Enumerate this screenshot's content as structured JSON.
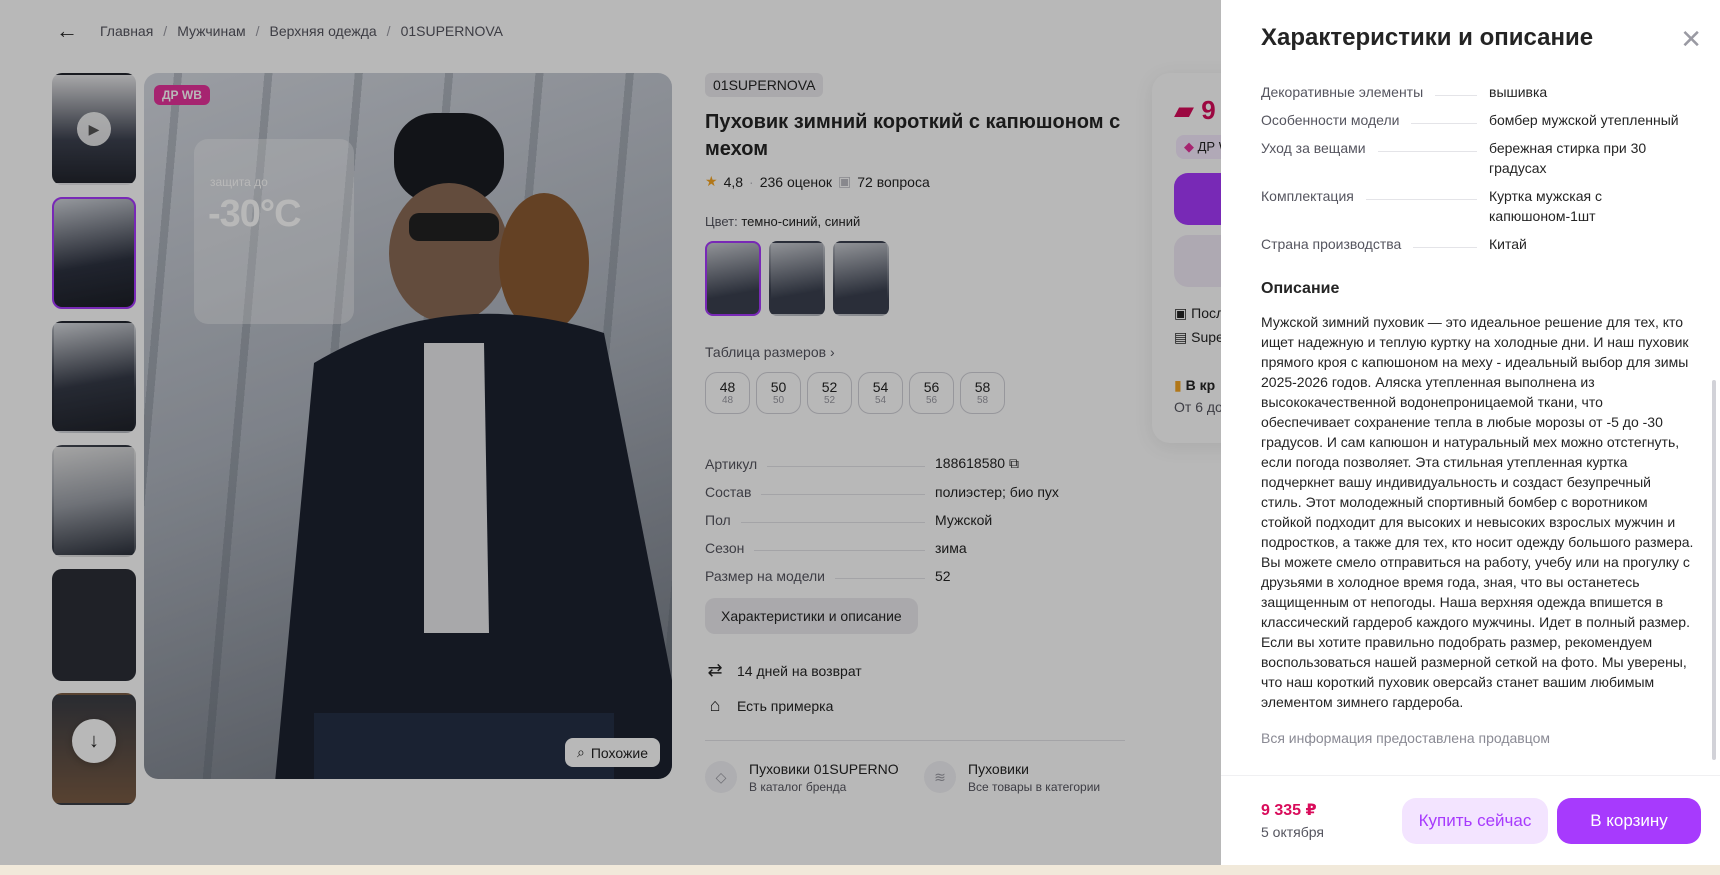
{
  "breadcrumb": {
    "items": [
      "Главная",
      "Мужчинам",
      "Верхняя одежда",
      "01SUPERNOVA"
    ]
  },
  "gallery": {
    "badge": "ДР WB",
    "protection_label": "защита до",
    "protection_value": "-30°C",
    "similar_label": "Похожие"
  },
  "product": {
    "brand": "01SUPERNOVA",
    "title": "Пуховик зимний короткий с капюшоном с мехом",
    "rating": "4,8",
    "reviews": "236 оценок",
    "questions": "72 вопроса",
    "color_label": "Цвет:",
    "color_value": "темно-синий, синий",
    "size_table_label": "Таблица размеров",
    "sizes": [
      {
        "main": "48",
        "sub": "48"
      },
      {
        "main": "50",
        "sub": "50"
      },
      {
        "main": "52",
        "sub": "52"
      },
      {
        "main": "54",
        "sub": "54"
      },
      {
        "main": "56",
        "sub": "56"
      },
      {
        "main": "58",
        "sub": "58"
      }
    ],
    "specs": [
      {
        "k": "Артикул",
        "v": "188618580"
      },
      {
        "k": "Состав",
        "v": "полиэстер; био пух"
      },
      {
        "k": "Пол",
        "v": "Мужской"
      },
      {
        "k": "Сезон",
        "v": "зима"
      },
      {
        "k": "Размер на модели",
        "v": "52"
      }
    ],
    "char_button": "Характеристики и описание",
    "features": [
      "14 дней на возврат",
      "Есть примерка"
    ],
    "links": [
      {
        "title": "Пуховики 01SUPERNOVA",
        "sub": "В каталог бренда"
      },
      {
        "title": "Пуховики",
        "sub": "Все товары в категории"
      }
    ]
  },
  "buybox": {
    "price_partial": "9",
    "badge_partial": "ДР W",
    "row1": "Посл",
    "row2": "Supe",
    "row3": "В кр",
    "row4": "От 6 до"
  },
  "panel": {
    "title": "Характеристики и описание",
    "specs": [
      {
        "k": "Декоративные элементы",
        "v": "вышивка"
      },
      {
        "k": "Особенности модели",
        "v": "бомбер мужской утепленный"
      },
      {
        "k": "Уход за вещами",
        "v": "бережная стирка при 30 градусах"
      },
      {
        "k": "Комплектация",
        "v": "Куртка мужская с капюшоном-1шт"
      },
      {
        "k": "Страна производства",
        "v": "Китай"
      }
    ],
    "desc_heading": "Описание",
    "description": "Мужской зимний пуховик — это идеальное решение для тех, кто ищет надежную и теплую куртку на холодные дни. И наш пуховик прямого кроя с капюшоном на меху - идеальный выбор для зимы 2025-2026 годов. Аляска утепленная выполнена из высококачественной водонепроницаемой ткани, что обеспечивает сохранение тепла в любые морозы от -5 до -30 градусов. И сам капюшон и натуральный мех можно отстегнуть, если погода позволяет. Эта стильная утепленная куртка подчеркнет вашу индивидуальность и создаст безупречный стиль. Этот молодежный спортивный бомбер с воротником стойкой подходит для высоких и невысоких взрослых мужчин и подростков, а также для тех, кто носит одежду большого размера. Вы можете смело отправиться на работу, учебу или на прогулку с друзьями в холодное время года, зная, что вы останетесь защищенным от непогоды. Наша верхняя одежда впишется в классический гардероб каждого мужчины. Идет в полный размер. Если вы хотите правильно подобрать размер, рекомендуем воспользоваться нашей размерной сеткой на фото. Мы уверены, что наш короткий пуховик оверсайз станет вашим любимым элементом зимнего гардероба.",
    "source_note": "Вся информация предоставлена продавцом",
    "price": "9 335 ₽",
    "delivery_date": "5 октября",
    "buy_now": "Купить сейчас",
    "add_to_cart": "В корзину"
  },
  "colors": {
    "accent": "#a73afd",
    "price": "#d90c5b",
    "badge": "#e6339b"
  }
}
